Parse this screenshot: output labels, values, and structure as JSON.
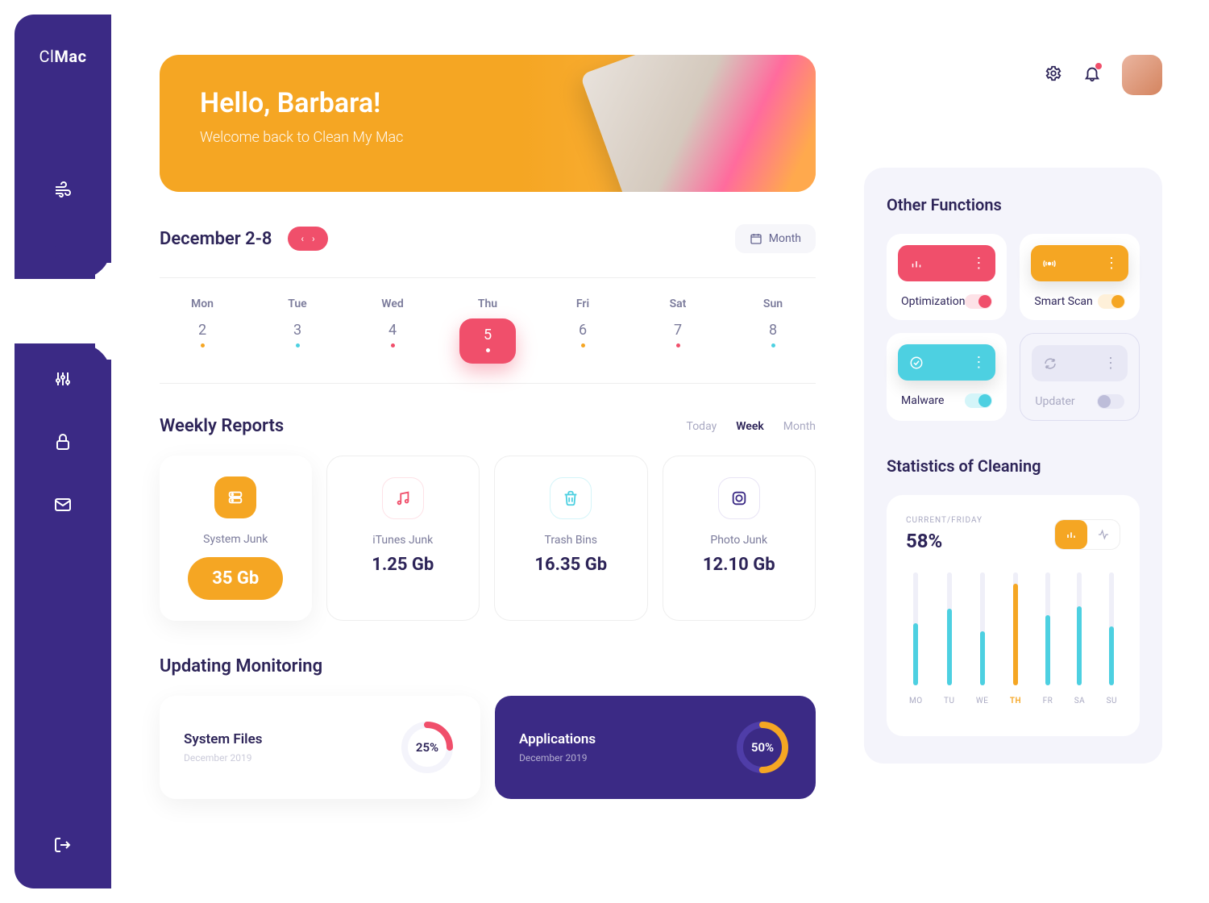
{
  "brand": {
    "prefix": "Cl",
    "name": "Mac"
  },
  "hero": {
    "greeting": "Hello, Barbara!",
    "subtitle": "Welcome back to Clean My Mac"
  },
  "dateRange": {
    "label": "December 2-8",
    "filterLabel": "Month"
  },
  "days": [
    {
      "name": "Mon",
      "num": "2",
      "dot": "#F5A623",
      "active": false
    },
    {
      "name": "Tue",
      "num": "3",
      "dot": "#4DD0E1",
      "active": false
    },
    {
      "name": "Wed",
      "num": "4",
      "dot": "#F04F6B",
      "active": false
    },
    {
      "name": "Thu",
      "num": "5",
      "dot": "#fff",
      "active": true
    },
    {
      "name": "Fri",
      "num": "6",
      "dot": "#F5A623",
      "active": false
    },
    {
      "name": "Sat",
      "num": "7",
      "dot": "#F04F6B",
      "active": false
    },
    {
      "name": "Sun",
      "num": "8",
      "dot": "#4DD0E1",
      "active": false
    }
  ],
  "reports": {
    "title": "Weekly Reports",
    "tabs": {
      "today": "Today",
      "week": "Week",
      "month": "Month"
    },
    "cards": [
      {
        "label": "System Junk",
        "value": "35 Gb"
      },
      {
        "label": "iTunes Junk",
        "value": "1.25 Gb"
      },
      {
        "label": "Trash Bins",
        "value": "16.35 Gb"
      },
      {
        "label": "Photo Junk",
        "value": "12.10 Gb"
      }
    ]
  },
  "monitoring": {
    "title": "Updating Monitoring",
    "items": [
      {
        "title": "System Files",
        "date": "December 2019",
        "pct": "25%"
      },
      {
        "title": "Applications",
        "date": "December 2019",
        "pct": "50%"
      }
    ]
  },
  "functions": {
    "title": "Other Functions",
    "items": [
      {
        "label": "Optimization"
      },
      {
        "label": "Smart Scan"
      },
      {
        "label": "Malware"
      },
      {
        "label": "Updater"
      }
    ]
  },
  "stats": {
    "title": "Statistics of Cleaning",
    "currentLabel": "CURRENT/FRIDAY",
    "pct": "58%"
  },
  "chart_data": {
    "type": "bar",
    "categories": [
      "MO",
      "TU",
      "WE",
      "TH",
      "FR",
      "SA",
      "SU"
    ],
    "values": [
      55,
      68,
      48,
      90,
      62,
      70,
      52
    ],
    "active_index": 3,
    "ylim": [
      0,
      100
    ],
    "colors": {
      "default": "#4DD0E1",
      "active": "#F5A623"
    }
  }
}
